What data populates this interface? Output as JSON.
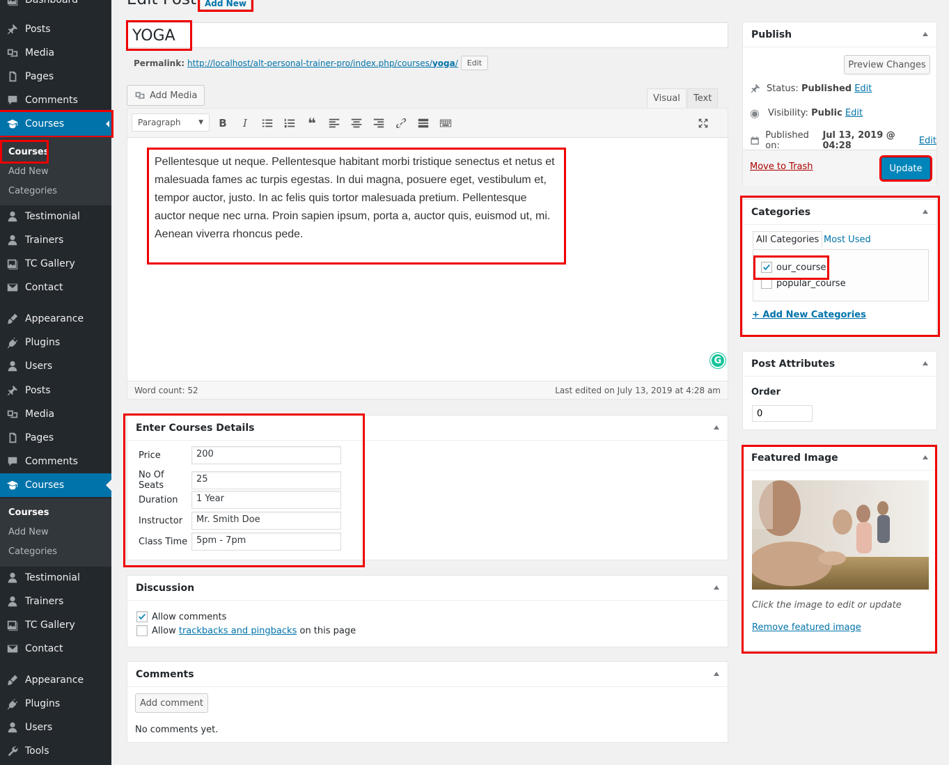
{
  "sidebar": {
    "top_partial": "Dashboard",
    "group1": [
      {
        "label": "Posts",
        "icon": "pin-icon"
      },
      {
        "label": "Media",
        "icon": "media-icon"
      },
      {
        "label": "Pages",
        "icon": "pages-icon"
      },
      {
        "label": "Comments",
        "icon": "comments-icon"
      },
      {
        "label": "Courses",
        "icon": "graduation-cap-icon"
      }
    ],
    "sub1": [
      "Courses",
      "Add New",
      "Categories"
    ],
    "group2": [
      {
        "label": "Testimonial",
        "icon": "user-icon"
      },
      {
        "label": "Trainers",
        "icon": "user-icon"
      },
      {
        "label": "TC Gallery",
        "icon": "gallery-icon"
      },
      {
        "label": "Contact",
        "icon": "envelope-icon"
      }
    ],
    "group3": [
      {
        "label": "Appearance",
        "icon": "brush-icon"
      },
      {
        "label": "Plugins",
        "icon": "plugin-icon"
      },
      {
        "label": "Users",
        "icon": "user-icon"
      },
      {
        "label": "Posts",
        "icon": "pin-icon"
      },
      {
        "label": "Media",
        "icon": "media-icon"
      },
      {
        "label": "Pages",
        "icon": "pages-icon"
      },
      {
        "label": "Comments",
        "icon": "comments-icon"
      },
      {
        "label": "Courses",
        "icon": "graduation-cap-icon"
      }
    ],
    "sub2": [
      "Courses",
      "Add New",
      "Categories"
    ],
    "group4": [
      {
        "label": "Testimonial",
        "icon": "user-icon"
      },
      {
        "label": "Trainers",
        "icon": "user-icon"
      },
      {
        "label": "TC Gallery",
        "icon": "gallery-icon"
      },
      {
        "label": "Contact",
        "icon": "envelope-icon"
      }
    ],
    "group5": [
      {
        "label": "Appearance",
        "icon": "brush-icon"
      },
      {
        "label": "Plugins",
        "icon": "plugin-icon"
      },
      {
        "label": "Users",
        "icon": "user-icon"
      },
      {
        "label": "Tools",
        "icon": "wrench-icon"
      }
    ]
  },
  "header": {
    "title": "Edit Post",
    "add_new": "Add New"
  },
  "post": {
    "title": "YOGA",
    "permalink_label": "Permalink:",
    "permalink_url": "http://localhost/alt-personal-trainer-pro/index.php/courses/",
    "permalink_slug": "yoga",
    "permalink_tail": "/",
    "permalink_edit": "Edit"
  },
  "editor": {
    "add_media": "Add Media",
    "tab_visual": "Visual",
    "tab_text": "Text",
    "format": "Paragraph",
    "content": "Pellentesque ut neque. Pellentesque habitant morbi tristique senectus et netus et malesuada fames ac turpis egestas. In dui magna, posuere eget, vestibulum et, tempor auctor, justo. In ac felis quis tortor malesuada pretium. Pellentesque auctor neque nec urna. Proin sapien ipsum, porta a, auctor quis, euismod ut, mi. Aenean viverra rhoncus pede.",
    "word_count": "Word count: 52",
    "last_edited": "Last edited on July 13, 2019 at 4:28 am",
    "grammarly": "G"
  },
  "course_details": {
    "title": "Enter Courses Details",
    "fields": [
      {
        "label": "Price",
        "value": "200"
      },
      {
        "label": "No Of Seats",
        "value": "25"
      },
      {
        "label": "Duration",
        "value": "1 Year"
      },
      {
        "label": "Instructor",
        "value": "Mr. Smith Doe"
      },
      {
        "label": "Class Time",
        "value": "5pm - 7pm"
      }
    ]
  },
  "discussion": {
    "title": "Discussion",
    "allow_comments": "Allow comments",
    "allow_prefix": "Allow",
    "trackbacks_link": "trackbacks and pingbacks",
    "allow_suffix": "on this page",
    "allow_comments_checked": true,
    "trackbacks_checked": false
  },
  "comments": {
    "title": "Comments",
    "add_button": "Add comment",
    "empty": "No comments yet."
  },
  "publish": {
    "title": "Publish",
    "preview": "Preview Changes",
    "status_label": "Status:",
    "status_value": "Published",
    "visibility_label": "Visibility:",
    "visibility_value": "Public",
    "published_label": "Published on:",
    "published_value": "Jul 13, 2019 @ 04:28",
    "edit": "Edit",
    "trash": "Move to Trash",
    "update": "Update"
  },
  "categories": {
    "title": "Categories",
    "tab_all": "All Categories",
    "tab_most": "Most Used",
    "items": [
      {
        "label": "our_course",
        "checked": true
      },
      {
        "label": "popular_course",
        "checked": false
      }
    ],
    "add_new": "+ Add New Categories"
  },
  "attributes": {
    "title": "Post Attributes",
    "order_label": "Order",
    "order_value": "0"
  },
  "featured": {
    "title": "Featured Image",
    "hint": "Click the image to edit or update",
    "remove": "Remove featured image"
  },
  "colors": {
    "accent": "#0073aa",
    "sidebar": "#23282d",
    "highlight": "#e00000",
    "button": "#0085ba"
  }
}
